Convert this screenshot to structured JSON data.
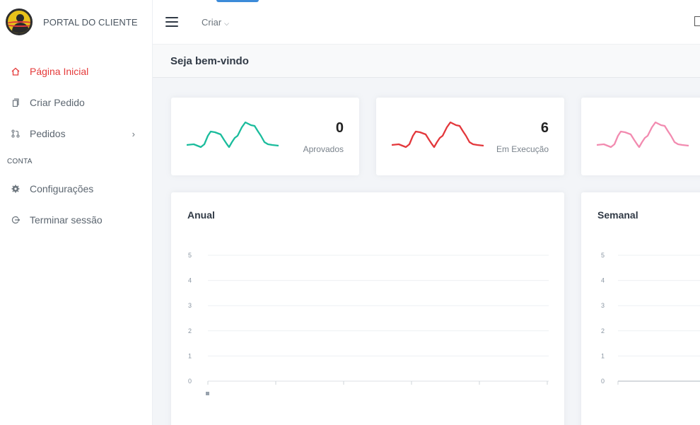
{
  "brand": {
    "title": "PORTAL DO CLIENTE"
  },
  "sidebar": {
    "items": [
      {
        "label": "Página Inicial",
        "icon": "home-icon",
        "active": true
      },
      {
        "label": "Criar Pedido",
        "icon": "document-icon"
      },
      {
        "label": "Pedidos",
        "icon": "git-pull-icon",
        "has_submenu": true
      }
    ],
    "section_label": "CONTA",
    "account_items": [
      {
        "label": "Configurações",
        "icon": "gear-icon"
      },
      {
        "label": "Terminar sessão",
        "icon": "logout-icon"
      }
    ]
  },
  "topbar": {
    "create_label": "Criar"
  },
  "page": {
    "welcome": "Seja bem-vindo"
  },
  "colors": {
    "accent": "#e53b3b",
    "approved": "#1abc9c",
    "in_progress": "#e3373b",
    "third": "#f28bb0"
  },
  "stats": [
    {
      "value": "0",
      "label": "Aprovados",
      "color": "#1abc9c"
    },
    {
      "value": "6",
      "label": "Em Execução",
      "color": "#e3373b"
    },
    {
      "value": "",
      "label": "",
      "color": "#f28bb0"
    }
  ],
  "chart_data": [
    {
      "type": "bar",
      "title": "Anual",
      "ylim": [
        0,
        5
      ],
      "yticks": [
        0,
        1,
        2,
        3,
        4,
        5
      ],
      "values": [
        0
      ],
      "grid": true
    },
    {
      "type": "line",
      "title": "Semanal",
      "ylim": [
        0,
        5
      ],
      "yticks": [
        0,
        1,
        2,
        3,
        4,
        5
      ],
      "values": [
        0
      ],
      "grid": true
    }
  ]
}
